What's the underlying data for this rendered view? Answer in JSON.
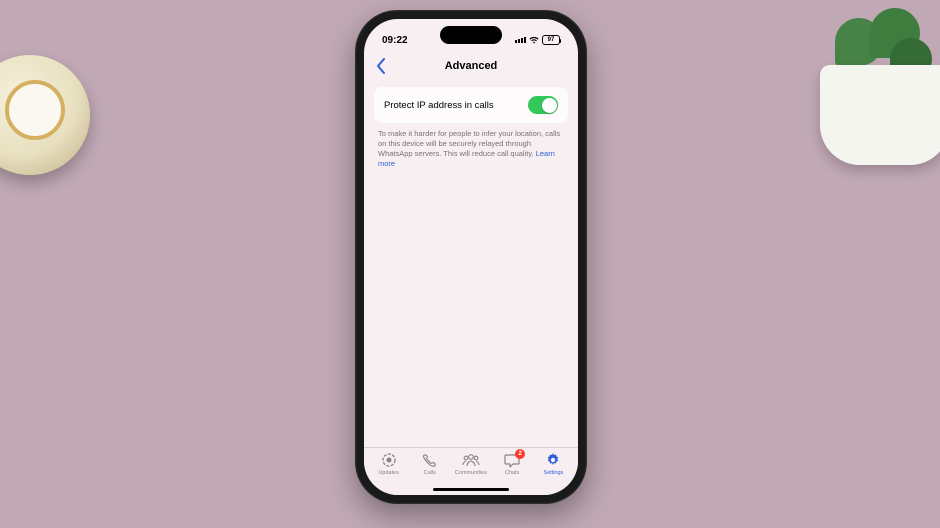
{
  "status": {
    "time": "09:22",
    "battery": "97"
  },
  "header": {
    "title": "Advanced"
  },
  "setting": {
    "label": "Protect IP address in calls",
    "enabled": true,
    "description": "To make it harder for people to infer your location, calls on this device will be securely relayed through WhatsApp servers. This will reduce call quality.",
    "learn_more": "Learn more"
  },
  "tabs": {
    "updates": "Updates",
    "calls": "Calls",
    "communities": "Communities",
    "chats": "Chats",
    "chats_badge": "2",
    "settings": "Settings"
  }
}
